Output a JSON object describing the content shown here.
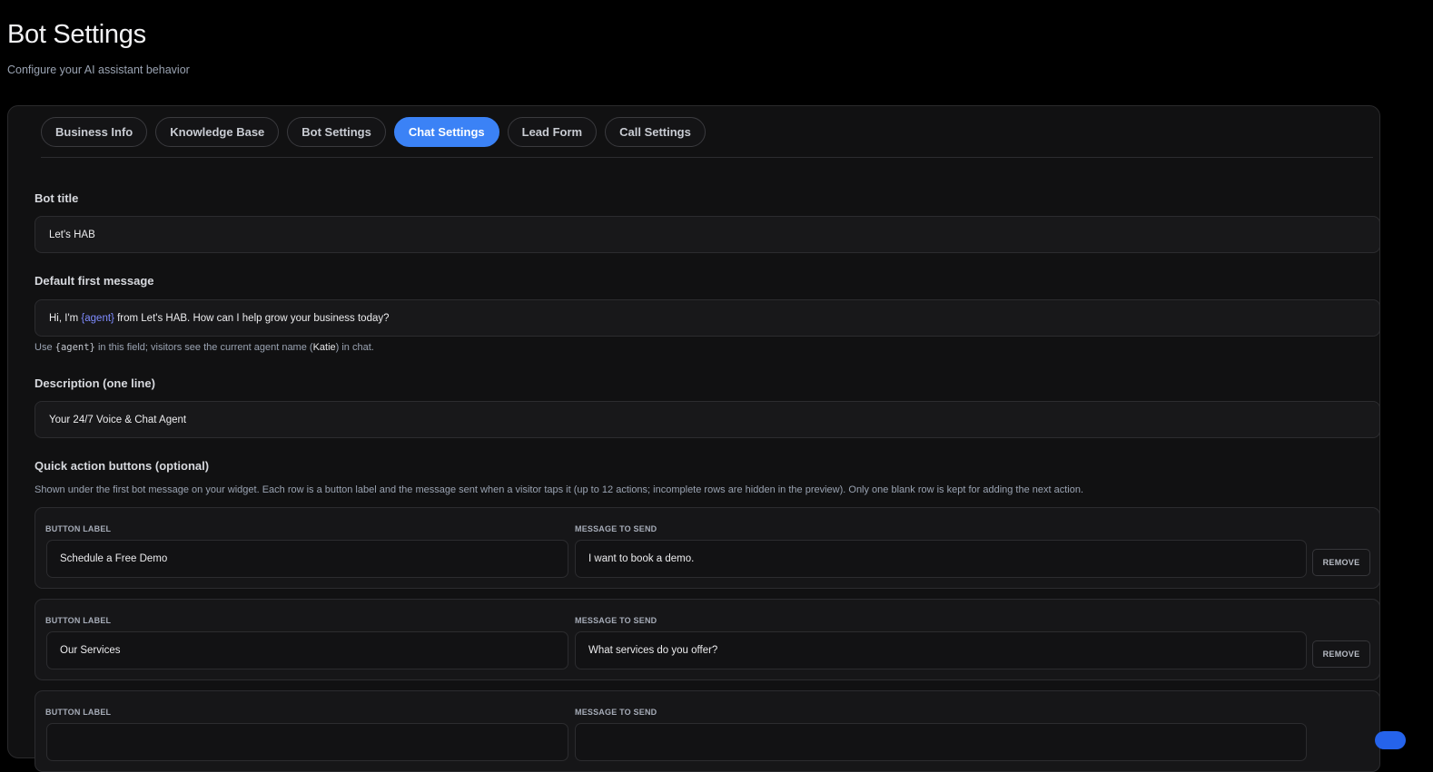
{
  "header": {
    "title": "Bot Settings",
    "subtitle": "Configure your AI assistant behavior"
  },
  "tabs": [
    {
      "label": "Business Info",
      "active": false
    },
    {
      "label": "Knowledge Base",
      "active": false
    },
    {
      "label": "Bot Settings",
      "active": false
    },
    {
      "label": "Chat Settings",
      "active": true
    },
    {
      "label": "Lead Form",
      "active": false
    },
    {
      "label": "Call Settings",
      "active": false
    }
  ],
  "form": {
    "bot_title": {
      "label": "Bot title",
      "value": "Let's HAB"
    },
    "first_message": {
      "label": "Default first message",
      "value_prefix": "Hi, I'm ",
      "value_token": "{agent}",
      "value_suffix": " from Let's HAB. How can I help grow your business today?",
      "help_prefix": "Use ",
      "help_token": "{agent}",
      "help_middle": " in this field; visitors see the current agent name (",
      "help_name": "Katie",
      "help_suffix": ") in chat."
    },
    "description": {
      "label": "Description (one line)",
      "value": "Your 24/7 Voice & Chat Agent"
    },
    "quick_actions": {
      "label": "Quick action buttons (optional)",
      "help": "Shown under the first bot message on your widget. Each row is a button label and the message sent when a visitor taps it (up to 12 actions; incomplete rows are hidden in the preview). Only one blank row is kept for adding the next action.",
      "col_label": "BUTTON LABEL",
      "col_message": "MESSAGE TO SEND",
      "remove_label": "REMOVE",
      "rows": [
        {
          "label": "Schedule a Free Demo",
          "message": "I want to book a demo."
        },
        {
          "label": "Our Services",
          "message": "What services do you offer?"
        },
        {
          "label": "",
          "message": ""
        }
      ]
    }
  },
  "colors": {
    "accent": "#3b82f6",
    "background": "#000000",
    "panel": "#111112",
    "token": "#7f8cff"
  }
}
